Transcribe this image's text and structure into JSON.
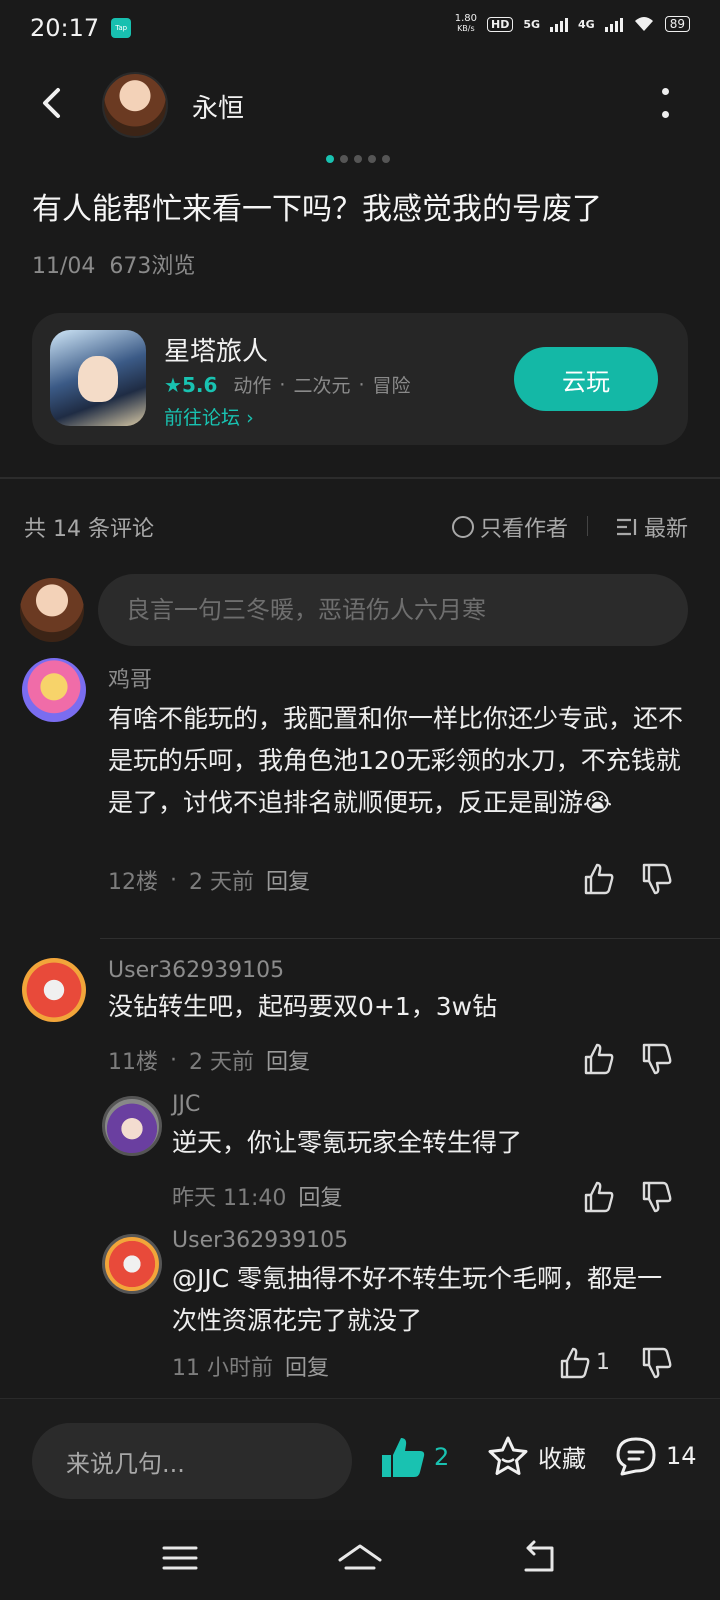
{
  "status_bar": {
    "time": "20:17",
    "app_badge": "Tap",
    "speed_top": "1.80",
    "speed_unit": "KB/s",
    "hd": "HD",
    "net1": "5G",
    "net2": "4G",
    "battery": "89"
  },
  "header": {
    "author_name": "永恒"
  },
  "post": {
    "title": "有人能帮忙来看一下吗？我感觉我的号废了",
    "date": "11/04",
    "views": "673浏览"
  },
  "game_card": {
    "name": "星塔旅人",
    "rating": "5.6",
    "tags": [
      "动作",
      "二次元",
      "冒险"
    ],
    "forum_link": "前往论坛",
    "play_button": "云玩"
  },
  "comments_header": {
    "count": "共 14 条评论",
    "author_only": "只看作者",
    "sort": "最新"
  },
  "reply_input": {
    "placeholder": "良言一句三冬暖，恶语伤人六月寒"
  },
  "comments": [
    {
      "name": "鸡哥",
      "body": "有啥不能玩的，我配置和你一样比你还少专武，还不是玩的乐呵，我角色池120无彩领的水刀，不充钱就是了，讨伐不追排名就顺便玩，反正是副游😭",
      "floor": "12楼",
      "time": "2 天前",
      "reply": "回复"
    },
    {
      "name": "User362939105",
      "body": "没钻转生吧，起码要双0+1，3w钻",
      "floor": "11楼",
      "time": "2 天前",
      "reply": "回复",
      "replies": [
        {
          "name": "JJC",
          "body": "逆天，你让零氪玩家全转生得了",
          "time": "昨天 11:40",
          "reply": "回复"
        },
        {
          "name": "User362939105",
          "mention": "@JJC",
          "body": "零氪抽得不好不转生玩个毛啊，都是一次性资源花完了就没了",
          "time": "11 小时前",
          "reply": "回复",
          "likes": "1"
        }
      ]
    }
  ],
  "bottom_bar": {
    "say_placeholder": "来说几句...",
    "like_count": "2",
    "favorite_label": "收藏",
    "comment_count": "14"
  },
  "colors": {
    "accent": "#19c2b1",
    "background": "#1a1a1a",
    "card": "#262626"
  }
}
